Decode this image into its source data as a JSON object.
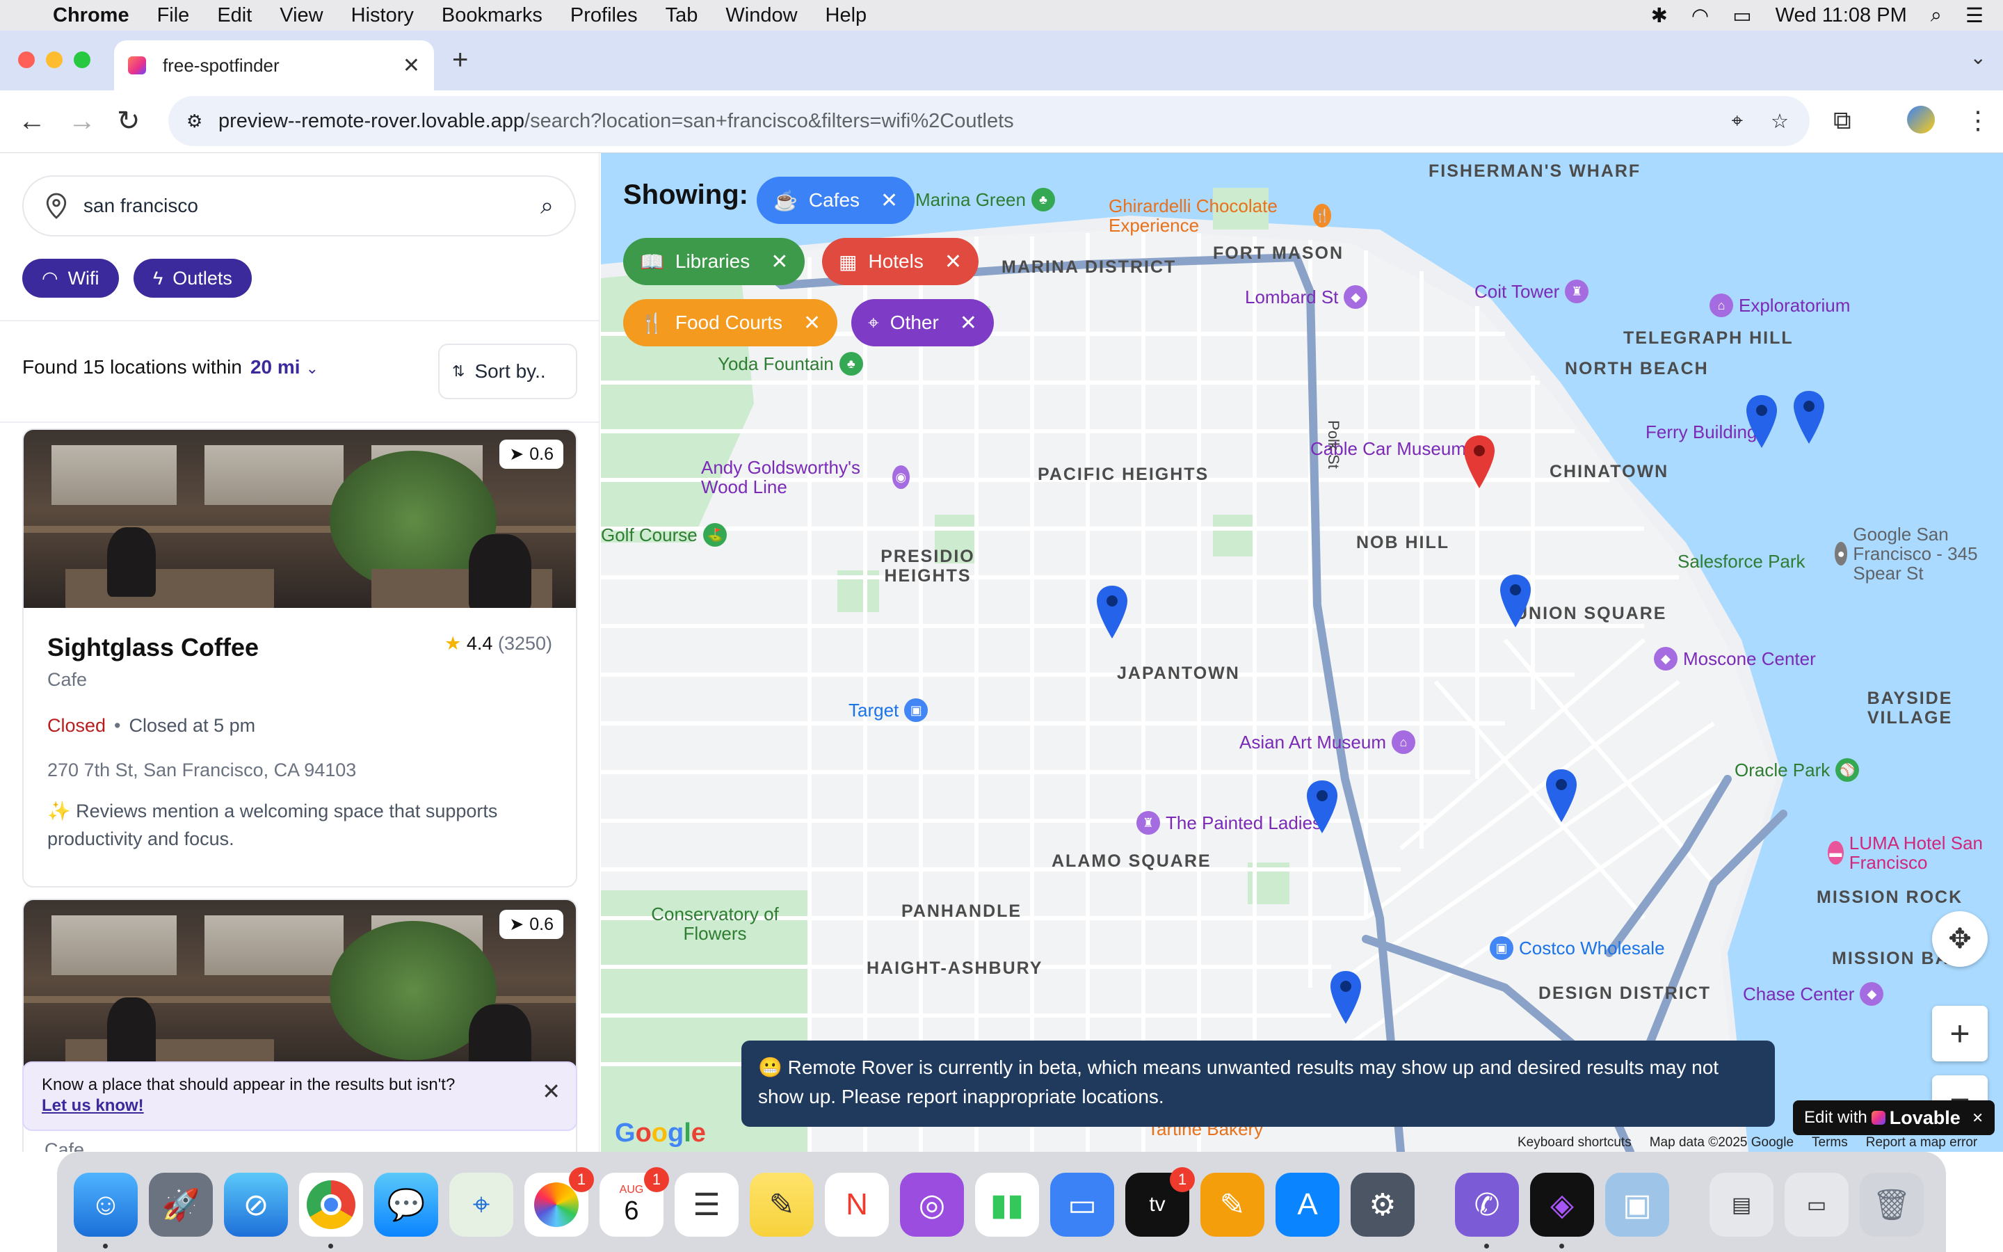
{
  "menubar": {
    "app": "Chrome",
    "items": [
      "File",
      "Edit",
      "View",
      "History",
      "Bookmarks",
      "Profiles",
      "Tab",
      "Window",
      "Help"
    ],
    "clock": "Wed 11:08 PM"
  },
  "browser": {
    "tab_title": "free-spotfinder",
    "url_host": "preview--remote-rover.lovable.app",
    "url_path": "/search?location=san+francisco&filters=wifi%2Coutlets"
  },
  "search": {
    "value": "san francisco",
    "filters": [
      "Wifi",
      "Outlets"
    ]
  },
  "results": {
    "found_text": "Found 15 locations within",
    "radius": "20 mi",
    "sort_label": "Sort by.."
  },
  "cards": [
    {
      "distance": "0.6",
      "name": "Sightglass Coffee",
      "rating": "4.4",
      "reviews": "(3250)",
      "type": "Cafe",
      "status": "Closed",
      "hours": "Closed at 5 pm",
      "address": "270 7th St, San Francisco, CA 94103",
      "review": "✨ Reviews mention a welcoming space that supports productivity and focus."
    },
    {
      "distance": "0.6",
      "type": "Cafe"
    }
  ],
  "suggest": {
    "text": "Know a place that should appear in the results but isn't?",
    "link": "Let us know!"
  },
  "map": {
    "showing_label": "Showing:",
    "filter_chips": [
      {
        "label": "Cafes",
        "color": "#3b82f6"
      },
      {
        "label": "Libraries",
        "color": "#3d9a4a"
      },
      {
        "label": "Hotels",
        "color": "#e04a3f"
      },
      {
        "label": "Food Courts",
        "color": "#f39a1f"
      },
      {
        "label": "Other",
        "color": "#7e3cc6"
      }
    ],
    "districts": [
      "FISHERMAN'S WHARF",
      "MARINA DISTRICT",
      "FORT MASON",
      "TELEGRAPH HILL",
      "NORTH BEACH",
      "PACIFIC HEIGHTS",
      "CHINATOWN",
      "NOB HILL",
      "PRESIDIO HEIGHTS",
      "UNION SQUARE",
      "JAPANTOWN",
      "BAYSIDE VILLAGE",
      "ALAMO SQUARE",
      "PANHANDLE",
      "HAIGHT-ASHBURY",
      "MISSION ROCK",
      "MISSION BAY",
      "DESIGN DISTRICT"
    ],
    "pois": [
      "Marina Green",
      "Ghirardelli Chocolate Experience",
      "Lombard St",
      "Coit Tower",
      "Exploratorium",
      "Yoda Fountain",
      "Andy Goldsworthy's Wood Line",
      "Cable Car Museum",
      "Ferry Building",
      "Google San Francisco - 345 Spear St",
      "Salesforce Park",
      "Moscone Center",
      "Target",
      "Asian Art Museum",
      "Oracle Park",
      "The Painted Ladies",
      "LUMA Hotel San Francisco",
      "Conservatory of Flowers",
      "Costco Wholesale",
      "Chase Center",
      "Tartine Bakery",
      "Golf Course"
    ],
    "beta_notice": "😬 Remote Rover is currently in beta, which means unwanted results may show up and desired results may not show up. Please report inappropriate locations.",
    "edit_with": "Edit with",
    "lovable": "Lovable",
    "attribution": [
      "Keyboard shortcuts",
      "Map data ©2025 Google",
      "Terms",
      "Report a map error"
    ],
    "google": "Google"
  },
  "dock": {
    "calendar_month": "AUG",
    "calendar_day": "6"
  }
}
